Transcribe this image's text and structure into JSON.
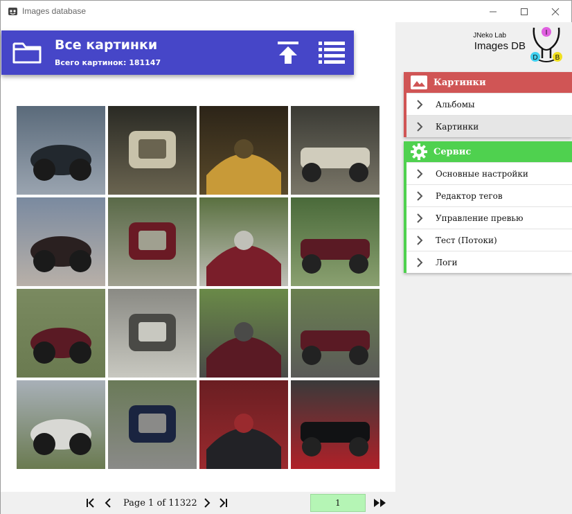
{
  "window": {
    "title": "Images database",
    "controls": {
      "minimize": "minimize-icon",
      "maximize": "maximize-icon",
      "close": "close-icon"
    }
  },
  "header": {
    "title": "Все картинки",
    "subtitle": "Всего картинок: 181147",
    "icons": [
      "folder-icon",
      "upload-icon",
      "list-view-icon"
    ]
  },
  "gallery": {
    "thumbnails": [
      {
        "subject": "motorcycle gauges",
        "colors": [
          "#5a6a7a",
          "#22282e",
          "#9aa4b0"
        ]
      },
      {
        "subject": "gauge closeup",
        "colors": [
          "#2a2a24",
          "#c8c2aa",
          "#6a6450"
        ]
      },
      {
        "subject": "engine detail",
        "colors": [
          "#2c2418",
          "#c89a38",
          "#5a4a2a"
        ]
      },
      {
        "subject": "gauge closeup",
        "colors": [
          "#3a3a34",
          "#d0ccbc",
          "#7a7668"
        ]
      },
      {
        "subject": "dark sedan",
        "colors": [
          "#7a8aa0",
          "#2a2020",
          "#b8b0a8"
        ]
      },
      {
        "subject": "red motorcycle front",
        "colors": [
          "#5a6a48",
          "#6a1a24",
          "#a0a090"
        ]
      },
      {
        "subject": "red motorcycle tank",
        "colors": [
          "#5a7040",
          "#7a1e2a",
          "#c0c0b8"
        ]
      },
      {
        "subject": "red cruiser side",
        "colors": [
          "#4a6a3a",
          "#5a1a24",
          "#8aa070"
        ]
      },
      {
        "subject": "red cruiser side",
        "colors": [
          "#7a8a60",
          "#5a1a24",
          "#6a7a50"
        ]
      },
      {
        "subject": "car interior",
        "colors": [
          "#8a8a84",
          "#4a4a46",
          "#c8c8c0"
        ]
      },
      {
        "subject": "red cruiser on road",
        "colors": [
          "#6a8a48",
          "#5a1a24",
          "#4a4a48"
        ]
      },
      {
        "subject": "red cruiser side",
        "colors": [
          "#6a8050",
          "#5a1a24",
          "#5a5a58"
        ]
      },
      {
        "subject": "white limousine",
        "colors": [
          "#a8b0b8",
          "#d8d8d4",
          "#6a7a50"
        ]
      },
      {
        "subject": "blue motorcycle",
        "colors": [
          "#6a7a58",
          "#1a2440",
          "#8a8a88"
        ]
      },
      {
        "subject": "handlebar grip",
        "colors": [
          "#6a1e22",
          "#222226",
          "#9a2a2e"
        ]
      },
      {
        "subject": "red flame tank",
        "colors": [
          "#3a3a3a",
          "#111214",
          "#b02028"
        ]
      }
    ]
  },
  "pager": {
    "text": "Page 1 of 11322",
    "input_value": "1",
    "icons": [
      "first-page-icon",
      "prev-page-icon",
      "next-page-icon",
      "last-page-icon",
      "go-icon"
    ]
  },
  "logo": {
    "line1": "JNeko Lab",
    "line2": "Images DB",
    "letters": [
      "I",
      "D",
      "B"
    ],
    "colors": [
      "#e060e0",
      "#40d0f0",
      "#f0e020"
    ]
  },
  "sidebar": {
    "pictures": {
      "label": "Картинки",
      "color": "#d05555",
      "items": [
        {
          "label": "Альбомы",
          "active": false
        },
        {
          "label": "Картинки",
          "active": true
        }
      ]
    },
    "service": {
      "label": "Сервис",
      "color": "#4fd14f",
      "items": [
        {
          "label": "Основные настройки"
        },
        {
          "label": "Редактор тегов"
        },
        {
          "label": "Управление превью"
        },
        {
          "label": "Тест (Потоки)"
        },
        {
          "label": "Логи"
        }
      ]
    }
  }
}
